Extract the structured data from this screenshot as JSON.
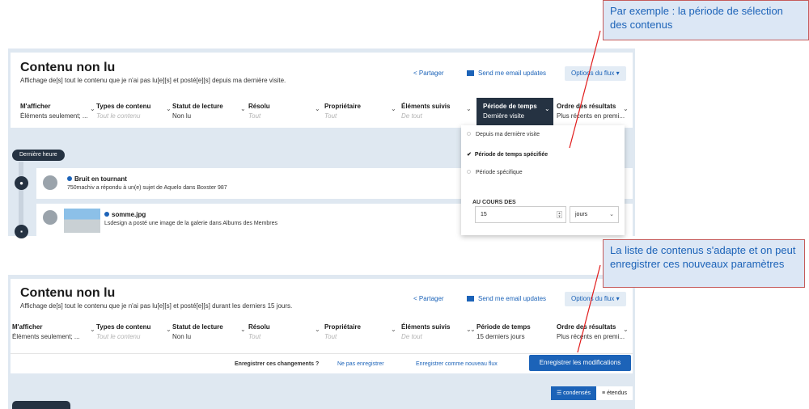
{
  "panel1": {
    "title": "Contenu non lu",
    "subtitle": "Affichage de[s] tout le contenu que je n'ai pas lu[e][s] et posté[e][s] depuis ma dernière visite.",
    "share": "Partager",
    "email": "Send me email updates",
    "options": "Options du flux ▾",
    "filters": [
      {
        "label": "M'afficher",
        "value": "Éléments seulement; ..."
      },
      {
        "label": "Types de contenu",
        "value": "Tout le contenu"
      },
      {
        "label": "Statut de lecture",
        "value": "Non lu"
      },
      {
        "label": "Résolu",
        "value": "Tout"
      },
      {
        "label": "Propriétaire",
        "value": "Tout"
      },
      {
        "label": "Éléments suivis",
        "value": "De tout"
      },
      {
        "label": "Période de temps",
        "value": "Dernière visite"
      },
      {
        "label": "Ordre des résultats",
        "value": "Plus récents en premi..."
      }
    ],
    "timeline_pill": "Dernière heure",
    "activities": [
      {
        "title": "Bruit en tournant",
        "sub": "750machiv a répondu à un(e) sujet de Aquelo dans Boxster 987"
      },
      {
        "title": "somme.jpg",
        "sub": "Lsdesign a posté une image de la galerie dans Albums des Membres"
      }
    ],
    "dropdown": {
      "options": [
        "Depuis ma dernière visite",
        "Période de temps spécifiée",
        "Période spécifique"
      ],
      "selected_index": 1,
      "range_label": "AU COURS DES",
      "range_value": "15",
      "range_unit": "jours"
    }
  },
  "panel2": {
    "title": "Contenu non lu",
    "subtitle": "Affichage de[s] tout le contenu que je n'ai pas lu[e][s] et posté[e][s] durant les derniers 15 jours.",
    "share": "Partager",
    "email": "Send me email updates",
    "options": "Options du flux ▾",
    "filters": [
      {
        "label": "M'afficher",
        "value": "Éléments seulement; ..."
      },
      {
        "label": "Types de contenu",
        "value": "Tout le contenu"
      },
      {
        "label": "Statut de lecture",
        "value": "Non lu"
      },
      {
        "label": "Résolu",
        "value": "Tout"
      },
      {
        "label": "Propriétaire",
        "value": "Tout"
      },
      {
        "label": "Éléments suivis",
        "value": "De tout"
      },
      {
        "label": "Période de temps",
        "value": "15 derniers jours"
      },
      {
        "label": "Ordre des résultats",
        "value": "Plus récents en premi..."
      }
    ],
    "save": {
      "question": "Enregistrer ces changements ?",
      "dont_save": "Ne pas enregistrer",
      "save_new": "Enregistrer comme nouveau flux",
      "save_changes": "Enregistrer les modifications"
    },
    "view": {
      "condensed": "condensés",
      "expanded": "étendus"
    }
  },
  "callouts": {
    "first": "Par exemple : la période de sélection des contenus",
    "second": "La liste de contenus s'adapte et on peut enregistrer ces nouveaux paramètres"
  },
  "colors": {
    "accent": "#1c63b8",
    "dark": "#253242",
    "panel_bg": "#dfe8f1",
    "annotation": "#e11b1b"
  }
}
